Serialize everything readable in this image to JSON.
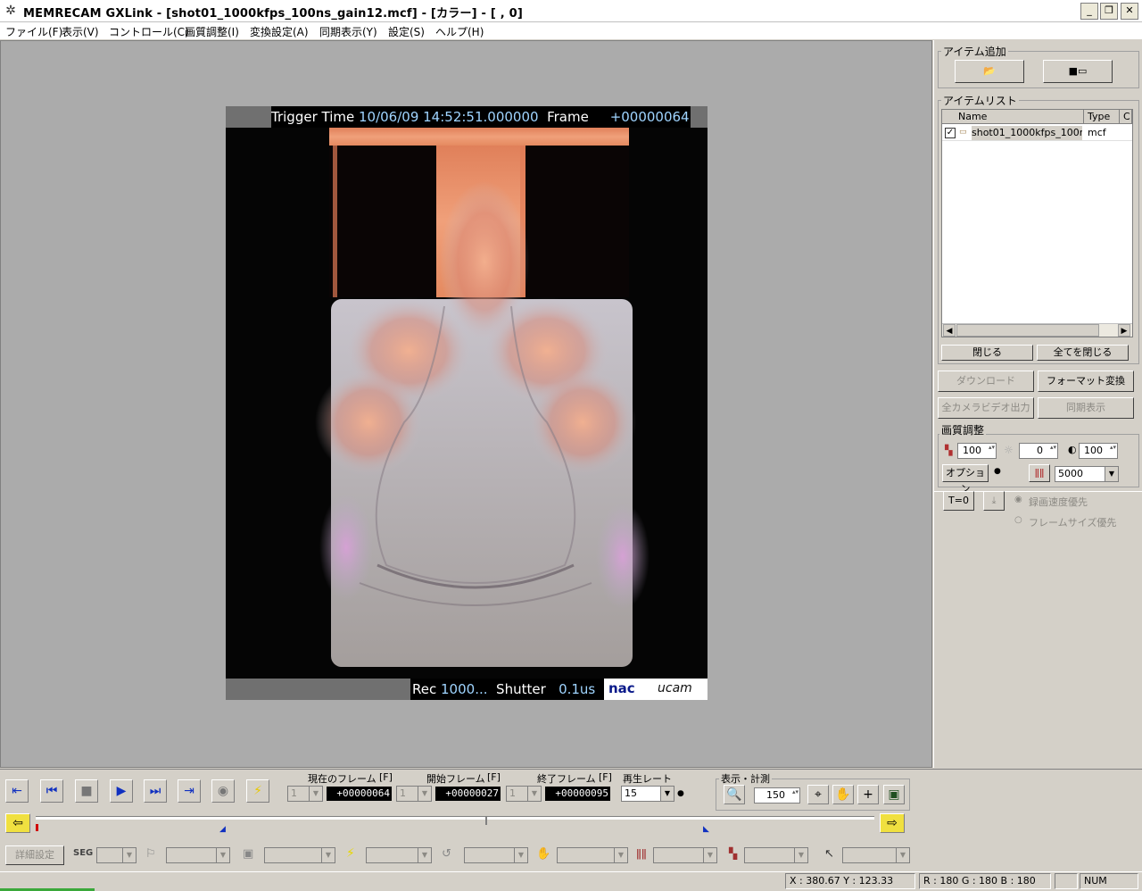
{
  "window": {
    "title": "MEMRECAM GXLink - [shot01_1000kfps_100ns_gain12.mcf] - [カラー] - [   ,   0]",
    "controls": [
      "_",
      "❐",
      "✕"
    ]
  },
  "menu": [
    "ファイル(F)",
    "表示(V)",
    "コントロール(C)",
    "画質調整(I)",
    "変換設定(A)",
    "同期表示(Y)",
    "設定(S)",
    "ヘルプ(H)"
  ],
  "viewer": {
    "trigger_label": "Trigger Time",
    "trigger_time": "10/06/09 14:52:51.000000",
    "frame_label": "Frame",
    "frame_number": "+00000064",
    "rec_label": "Rec",
    "rec_value": "1000...",
    "shutter_label": "Shutter",
    "shutter_value": "0.1us",
    "logo_nac": "nac",
    "logo_ucam": "ucam"
  },
  "panel": {
    "add_item_title": "アイテム追加",
    "item_list_title": "アイテムリスト",
    "columns": [
      "Name",
      "Type",
      "C"
    ],
    "items": [
      {
        "name": "shot01_1000kfps_100n...",
        "type": "mcf",
        "checked": true
      }
    ],
    "close_button": "閉じる",
    "close_all_button": "全てを閉じる",
    "download_button": "ダウンロード",
    "format_convert_button": "フォーマット変換",
    "all_camera_video_button": "全カメラビデオ出力",
    "sync_display_button": "同期表示",
    "image_adjust_title": "画質調整",
    "contrast_value": "100",
    "brightness_value": "0",
    "gamma_value": "100",
    "option_button": "オプション",
    "color_temp_value": "5000",
    "t0_button": "T=0",
    "radio_speed_priority": "録画速度優先",
    "radio_size_priority": "フレームサイズ優先"
  },
  "controls": {
    "current_frame_label": "現在のフレーム",
    "current_frame_unit": "[F]",
    "current_frame_select": "1",
    "current_frame_value": "+00000064",
    "start_frame_label": "開始フレーム",
    "start_frame_unit": "[F]",
    "start_frame_select": "1",
    "start_frame_value": "+00000027",
    "end_frame_label": "終了フレーム",
    "end_frame_unit": "[F]",
    "end_frame_select": "1",
    "end_frame_value": "+00000095",
    "playback_rate_label": "再生レート",
    "playback_rate_value": "15",
    "display_measure_label": "表示・計測",
    "zoom_value": "150",
    "detail_settings_button": "詳細設定",
    "seg_label": "SEG"
  },
  "status": {
    "coords": "X : 380.67   Y : 123.33",
    "rgb": "R : 180   G : 180   B : 180",
    "num": "NUM"
  },
  "colors": {
    "title_bg": "#ffffff",
    "viewer_bg": "#ababab",
    "panel_bg": "#d4d0c8",
    "accent_blue": "#1030c0"
  }
}
